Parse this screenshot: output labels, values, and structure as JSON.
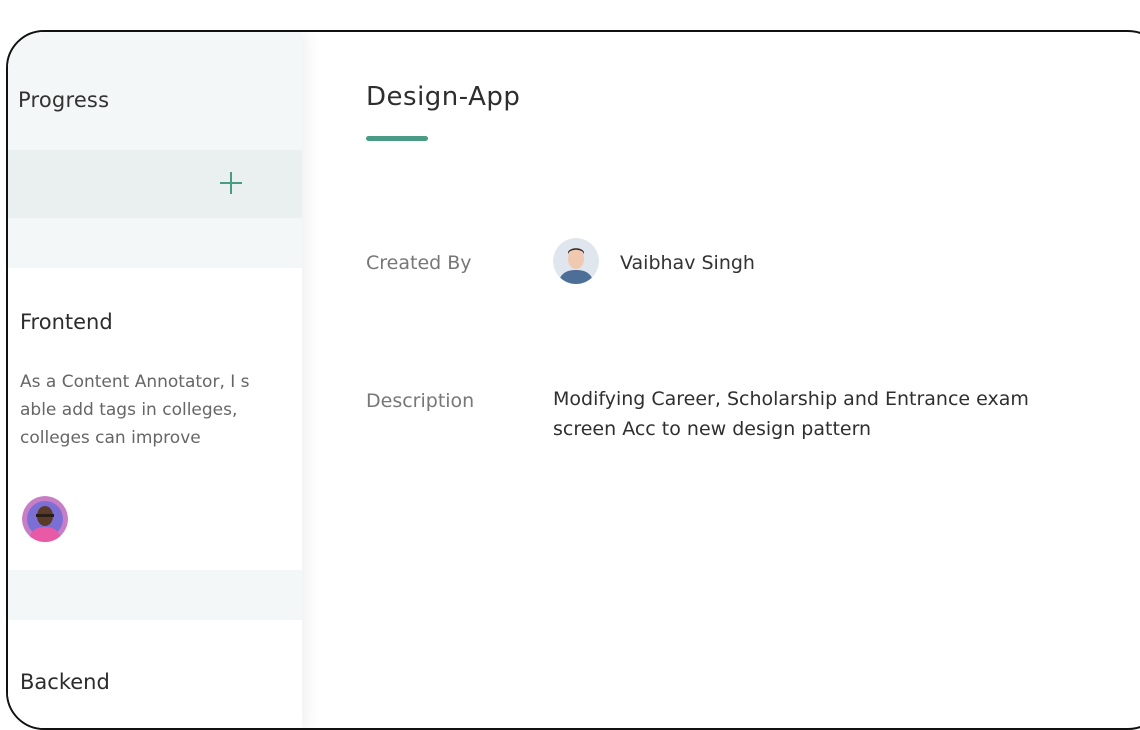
{
  "column": {
    "title": "Progress",
    "add_icon": "plus-icon"
  },
  "cards": [
    {
      "title": "Frontend",
      "description_lines": [
        "As a Content Annotator, I s",
        "able add tags in colleges,",
        "colleges can improve"
      ],
      "assignee_avatar": "avatar"
    },
    {
      "title": "Backend"
    }
  ],
  "detail": {
    "title": "Design-App",
    "created_by_label": "Created By",
    "created_by_name": "Vaibhav Singh",
    "description_label": "Description",
    "description_lines": [
      "Modifying Career, Scholarship and Entrance exam",
      "screen Acc to new design pattern"
    ]
  },
  "colors": {
    "accent": "#4a9b84",
    "panel_bg": "#f3f7f7",
    "add_bar_bg": "#e9f0ef"
  }
}
